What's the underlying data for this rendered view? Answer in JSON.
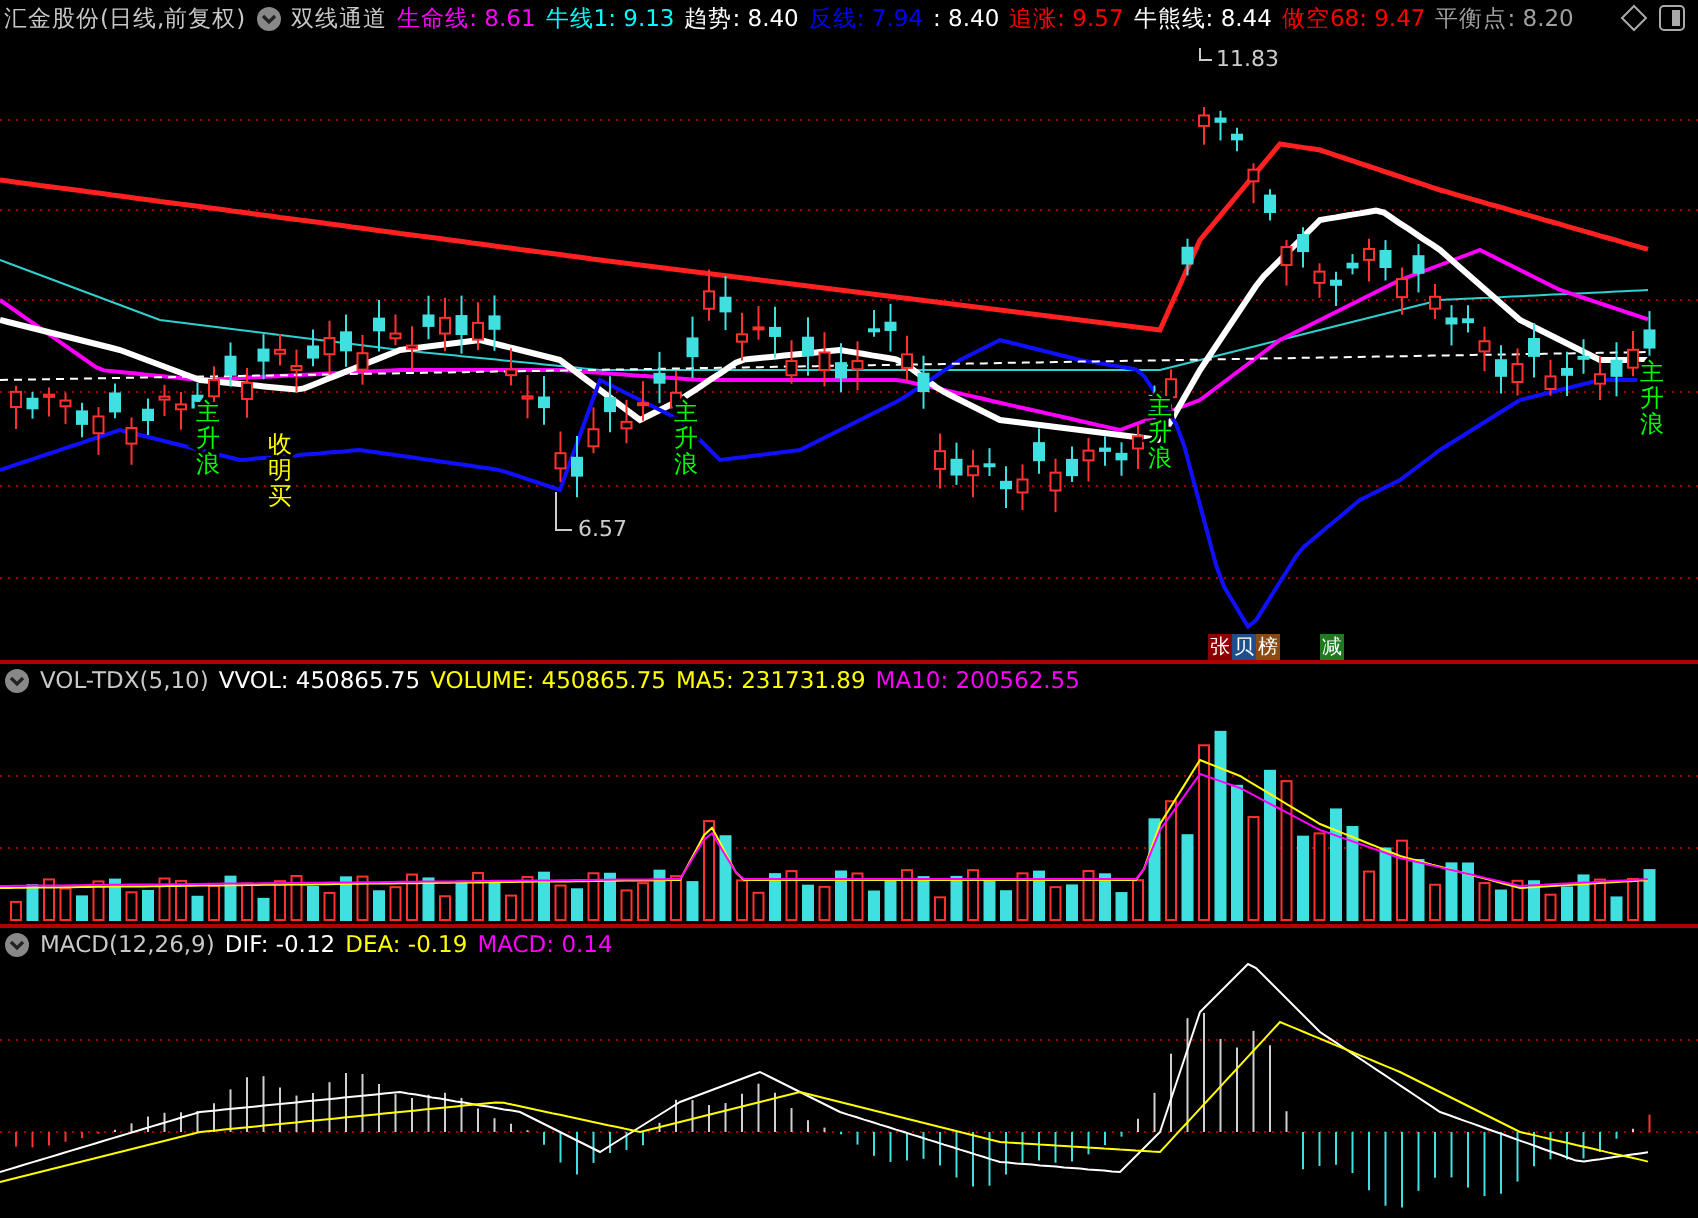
{
  "header": {
    "title": "汇金股份(日线,前复权)",
    "indicator": "双线通道",
    "readings": [
      {
        "text": "生命线: 8.61",
        "color": "#ff00ff"
      },
      {
        "text": "牛线1: 9.13",
        "color": "#00ffff"
      },
      {
        "text": "趋势: 8.40",
        "color": "#ffffff"
      },
      {
        "text": "反线: 7.94",
        "color": "#0000ff"
      },
      {
        "text": ": 8.40",
        "color": "#ffffff"
      },
      {
        "text": "追涨: 9.57",
        "color": "#ff0000"
      },
      {
        "text": "牛熊线: 8.44",
        "color": "#ffffff"
      },
      {
        "text": "做空68: 9.47",
        "color": "#ff0000"
      },
      {
        "text": "平衡点: 8.20",
        "color": "#a0a0a0"
      }
    ]
  },
  "main_chart": {
    "high_label": "11.83",
    "low_label": "6.57",
    "signals": [
      {
        "text": "主升浪",
        "color": "#00ff00"
      },
      {
        "text": "收明买",
        "color": "#ffff00"
      },
      {
        "text": "主升浪",
        "color": "#00ff00"
      },
      {
        "text": "主升浪",
        "color": "#00ff00"
      },
      {
        "text": "主升浪",
        "color": "#00ff00"
      }
    ],
    "badges": [
      {
        "text": "张",
        "color": "#8b0000"
      },
      {
        "text": "贝",
        "color": "#1f4e8c"
      },
      {
        "text": "榜",
        "color": "#8b4a10"
      },
      {
        "text": "减",
        "color": "#1e7a1e"
      }
    ]
  },
  "volume": {
    "title": "VOL-TDX(5,10)",
    "readings": [
      {
        "text": "VVOL: 450865.75",
        "color": "#ffffff"
      },
      {
        "text": "VOLUME: 450865.75",
        "color": "#ffff00"
      },
      {
        "text": "MA5: 231731.89",
        "color": "#ffff00"
      },
      {
        "text": "MA10: 200562.55",
        "color": "#ff00ff"
      }
    ]
  },
  "macd": {
    "title": "MACD(12,26,9)",
    "readings": [
      {
        "text": "DIF: -0.12",
        "color": "#ffffff"
      },
      {
        "text": "DEA: -0.19",
        "color": "#ffff00"
      },
      {
        "text": "MACD: 0.14",
        "color": "#ff00ff"
      }
    ]
  }
}
